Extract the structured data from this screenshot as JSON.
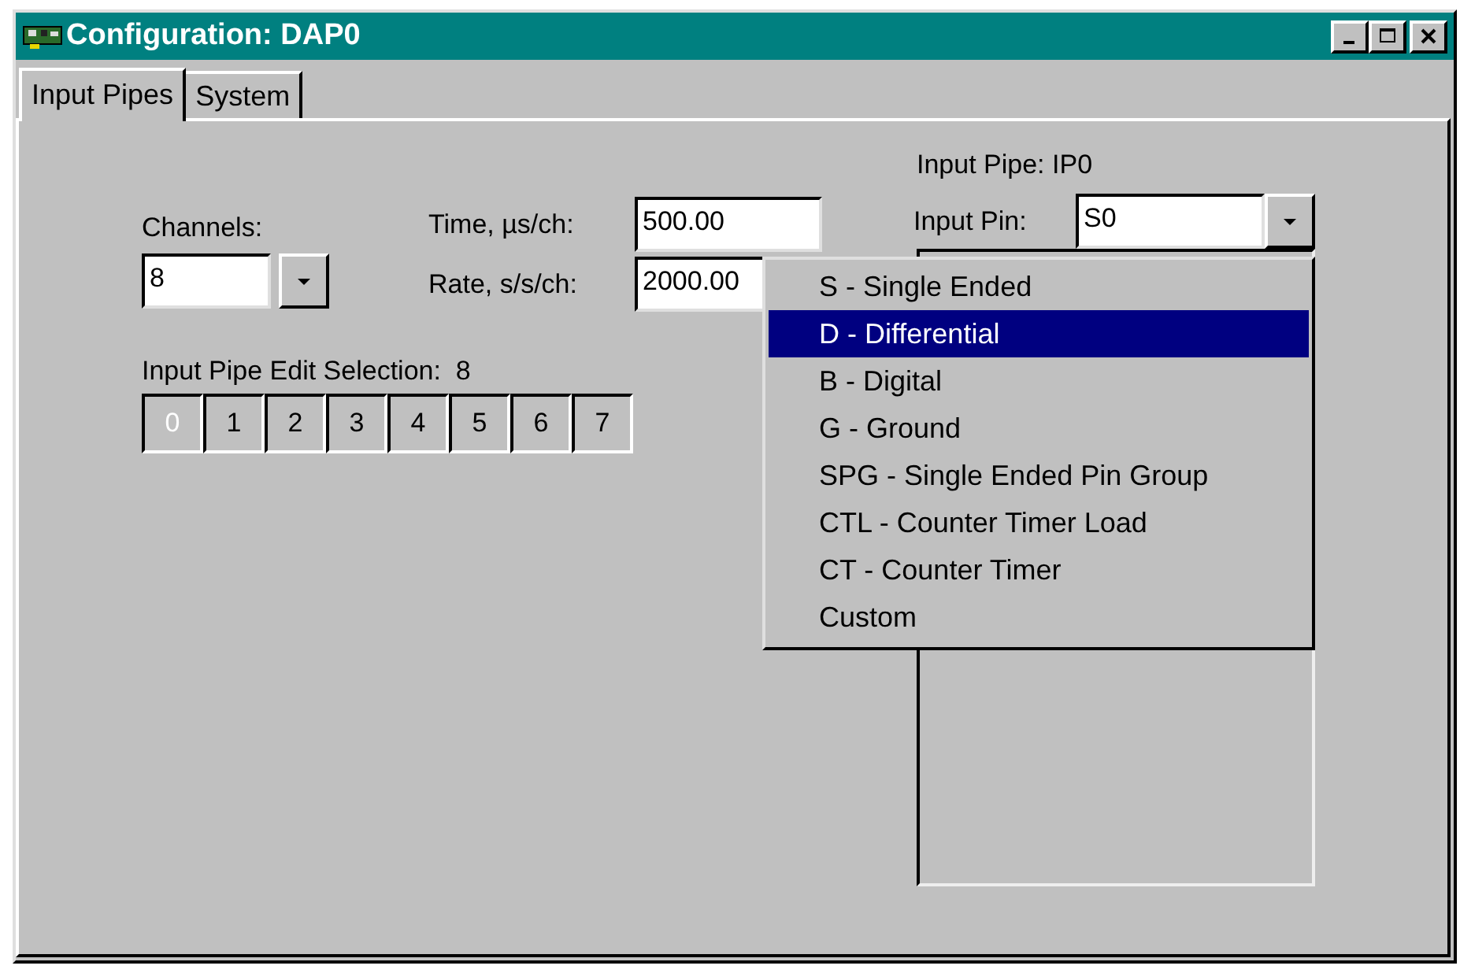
{
  "window": {
    "title": "Configuration: DAP0"
  },
  "tabs": [
    {
      "label": "Input Pipes",
      "selected": true
    },
    {
      "label": "System",
      "selected": false
    }
  ],
  "channels": {
    "label": "Channels:",
    "value": "8"
  },
  "time": {
    "label": "Time, µs/ch:",
    "value": "500.00"
  },
  "rate": {
    "label": "Rate, s/s/ch:",
    "value": "2000.00"
  },
  "input_pipe": {
    "label": "Input Pipe: IP0"
  },
  "input_pin": {
    "label": "Input Pin:",
    "value": "S0"
  },
  "edit_selection": {
    "label": "Input Pipe Edit Selection:  8",
    "buttons": [
      {
        "label": "0",
        "disabled": true
      },
      {
        "label": "1",
        "disabled": false
      },
      {
        "label": "2",
        "disabled": false
      },
      {
        "label": "3",
        "disabled": false
      },
      {
        "label": "4",
        "disabled": false
      },
      {
        "label": "5",
        "disabled": false
      },
      {
        "label": "6",
        "disabled": false
      },
      {
        "label": "7",
        "disabled": false
      }
    ]
  },
  "pin_options": [
    {
      "label": "S - Single Ended",
      "selected": false
    },
    {
      "label": "D - Differential",
      "selected": true
    },
    {
      "label": "B - Digital",
      "selected": false
    },
    {
      "label": "G - Ground",
      "selected": false
    },
    {
      "label": "SPG - Single Ended Pin Group",
      "selected": false
    },
    {
      "label": "CTL - Counter Timer Load",
      "selected": false
    },
    {
      "label": "CT - Counter Timer",
      "selected": false
    },
    {
      "label": "Custom",
      "selected": false
    }
  ]
}
